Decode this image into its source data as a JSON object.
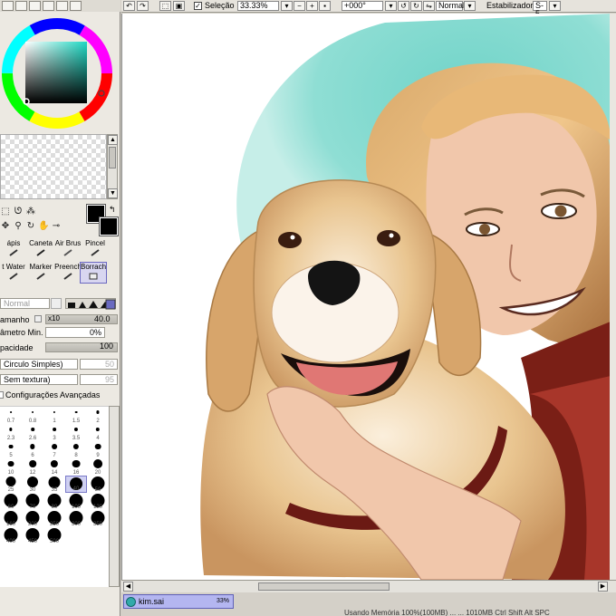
{
  "toolbar": {
    "selection_label": "Seleção",
    "selection_checked": true,
    "zoom": "33.33%",
    "rotation": "+000°",
    "blend_mode": "Normal",
    "stabilizer_label": "Estabilizador",
    "stabilizer_value": "S-5"
  },
  "brushes": [
    {
      "label": "ápis"
    },
    {
      "label": "Caneta"
    },
    {
      "label": "Air Brus"
    },
    {
      "label": "Pincel"
    },
    {
      "label": "t Water"
    },
    {
      "label": "Marker"
    },
    {
      "label": "Preench"
    },
    {
      "label": "Borrach",
      "selected": true
    }
  ],
  "brush_props": {
    "mode": "Normal",
    "size_label": "amanho",
    "size_mult": "x10",
    "size_value": "40.0",
    "min_size_label": "âmetro Min.",
    "min_size_value": "0%",
    "opacity_label": "pacidade",
    "opacity_value": "100",
    "shape": "Circulo Simples)",
    "shape_value": "50",
    "texture": "Sem textura)",
    "texture_value": "95",
    "advanced_label": "Configurações Avançadas"
  },
  "brush_sizes": [
    "0.7",
    "0.8",
    "1",
    "1.5",
    "2",
    "2.3",
    "2.6",
    "3",
    "3.5",
    "4",
    "5",
    "6",
    "7",
    "8",
    "9",
    "10",
    "12",
    "14",
    "16",
    "20",
    "25",
    "30",
    "35",
    "40",
    "50",
    "60",
    "70",
    "80",
    "100",
    "120",
    "160",
    "200",
    "250",
    "300",
    "350",
    "400",
    "450",
    "500"
  ],
  "selected_size": "40",
  "file": {
    "name": "kim.sai",
    "zoom": "33%"
  },
  "status_text": "Usando Memória 100%(100MB) ... ... 1010MB  Ctrl  Shift  Alt  SPC",
  "colors": {
    "accent_tab": "#b4b6f0",
    "background_teal": "#7fd6cc",
    "foreground": "#000000"
  }
}
